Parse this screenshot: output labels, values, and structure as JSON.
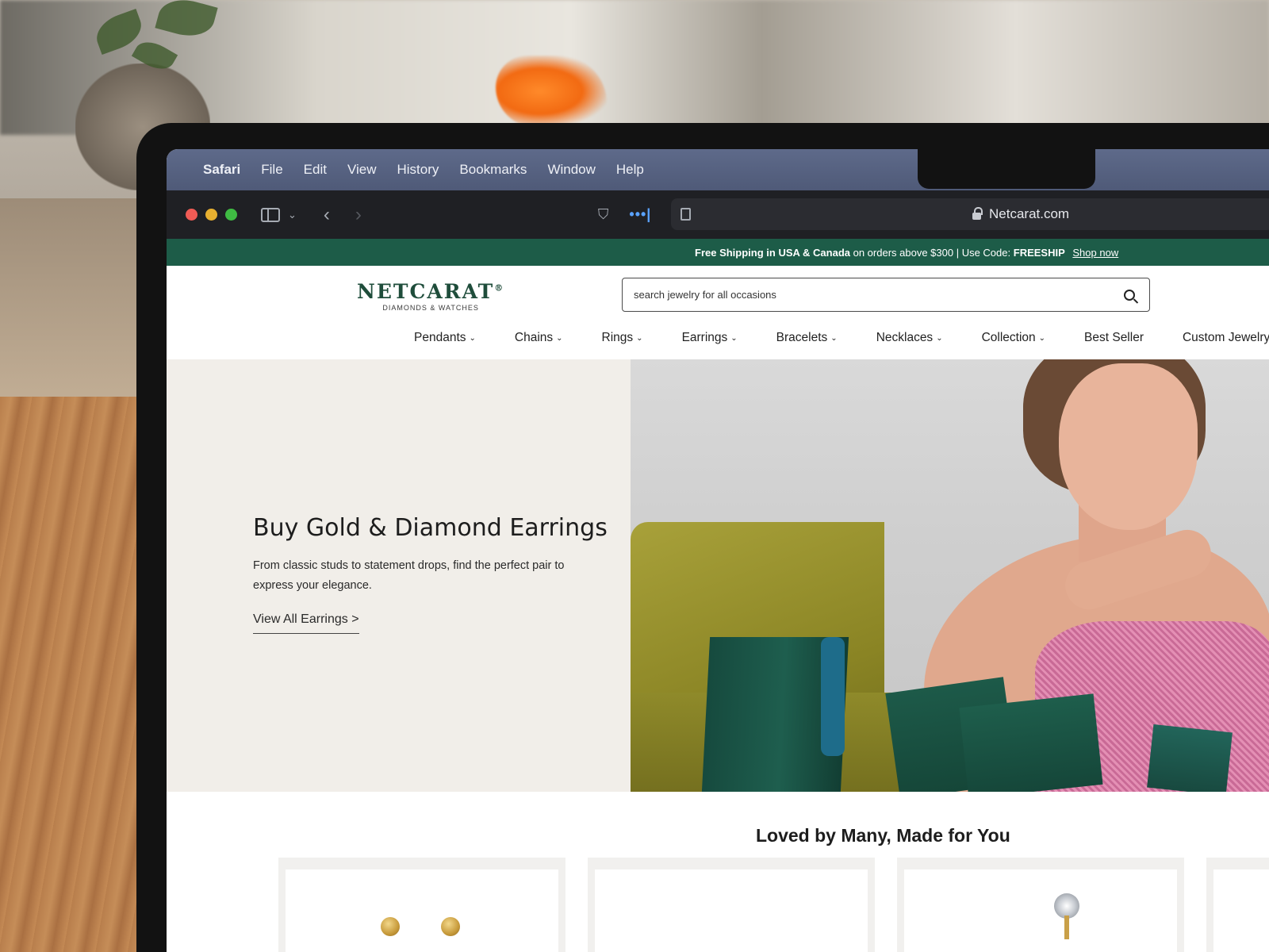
{
  "menubar": {
    "app": "Safari",
    "items": [
      "File",
      "Edit",
      "View",
      "History",
      "Bookmarks",
      "Window",
      "Help"
    ]
  },
  "browser": {
    "url": "Netcarat.com"
  },
  "promo": {
    "text_bold": "Free Shipping in USA & Canada",
    "text_mid": "on orders above $300 | Use Code:",
    "code": "FREESHIP",
    "link": "Shop now",
    "color": "#1d5c48"
  },
  "header": {
    "logo_main": "NETCARAT",
    "logo_reg": "®",
    "logo_sub": "DIAMONDS & WATCHES",
    "search_placeholder": "search jewelry for all occasions"
  },
  "nav": {
    "items": [
      {
        "label": "Pendants",
        "chevron": "⌄"
      },
      {
        "label": "Chains",
        "chevron": "⌄"
      },
      {
        "label": "Rings",
        "chevron": "⌄"
      },
      {
        "label": "Earrings",
        "chevron": "⌄"
      },
      {
        "label": "Bracelets",
        "chevron": "⌄"
      },
      {
        "label": "Necklaces",
        "chevron": "⌄"
      },
      {
        "label": "Collection",
        "chevron": "⌄"
      },
      {
        "label": "Best Seller",
        "chevron": ""
      },
      {
        "label": "Custom Jewelry",
        "chevron": ""
      }
    ]
  },
  "hero": {
    "title": "Buy Gold & Diamond Earrings",
    "description": "From classic studs to statement drops, find the perfect pair to express your elegance.",
    "link": "View All Earrings >"
  },
  "products": {
    "title": "Loved by Many, Made for You"
  }
}
